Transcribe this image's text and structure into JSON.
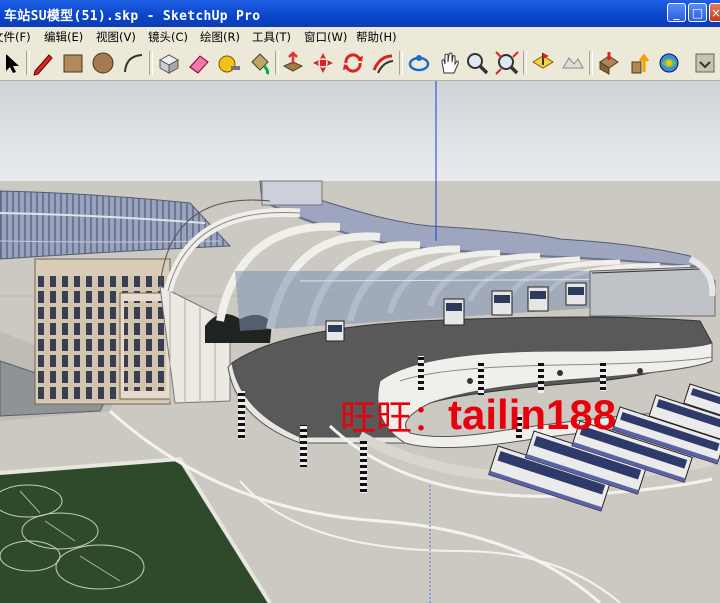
{
  "window": {
    "title": "车站SU模型(51).skp - SketchUp Pro",
    "minimize_label": "_",
    "maximize_label": "□",
    "close_label": "×"
  },
  "menu": [
    {
      "label": "文件(F)"
    },
    {
      "label": "编辑(E)"
    },
    {
      "label": "视图(V)"
    },
    {
      "label": "镜头(C)"
    },
    {
      "label": "绘图(R)"
    },
    {
      "label": "工具(T)"
    },
    {
      "label": "窗口(W)"
    },
    {
      "label": "帮助(H)"
    }
  ],
  "toolbar": [
    "select-icon",
    "pencil-icon",
    "rectangle-icon",
    "circle-icon",
    "arc-icon",
    "make-component-icon",
    "eraser-icon",
    "tape-measure-icon",
    "paint-bucket-icon",
    "push-pull-icon",
    "move-icon",
    "rotate-icon",
    "offset-icon",
    "orbit-icon",
    "pan-icon",
    "zoom-icon",
    "zoom-extents-icon",
    "add-location-icon",
    "toggle-terrain-icon",
    "get-models-icon",
    "share-model-icon",
    "share-component-icon"
  ],
  "watermark": {
    "prefix": "旺旺：",
    "id": "tailin188"
  },
  "colors": {
    "titlebar": "#0a45c8",
    "ui": "#ece9d8",
    "sky": "#d9dde2",
    "ground": "#ccc9c2",
    "watermark": "#e8000d",
    "grass": "#2e4a2a"
  }
}
